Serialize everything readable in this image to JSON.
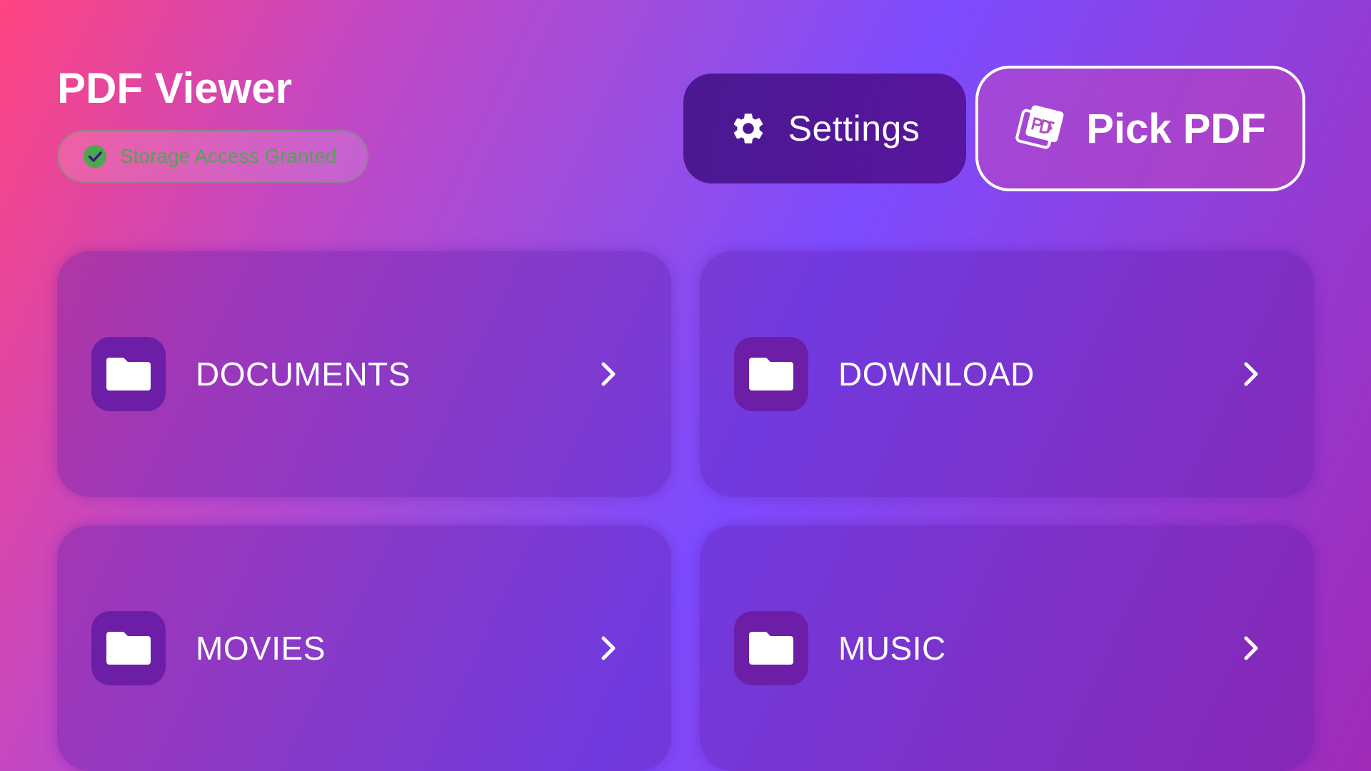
{
  "header": {
    "title": "PDF Viewer",
    "storage_status": "Storage Access Granted",
    "storage_status_icon": "check-circle-icon",
    "storage_status_color": "#4ca84e"
  },
  "toolbar": {
    "settings_label": "Settings",
    "settings_icon": "gear-icon",
    "pick_pdf_label": "Pick PDF",
    "pick_pdf_icon": "pdf-file-icon"
  },
  "folders": [
    {
      "label": "DOCUMENTS",
      "icon": "folder-icon"
    },
    {
      "label": "DOWNLOAD",
      "icon": "folder-icon"
    },
    {
      "label": "MOVIES",
      "icon": "folder-icon"
    },
    {
      "label": "MUSIC",
      "icon": "folder-icon"
    }
  ],
  "colors": {
    "settings_button": "#4a1891",
    "folder_tile": "#6c1fa6",
    "text": "#ffffff"
  }
}
